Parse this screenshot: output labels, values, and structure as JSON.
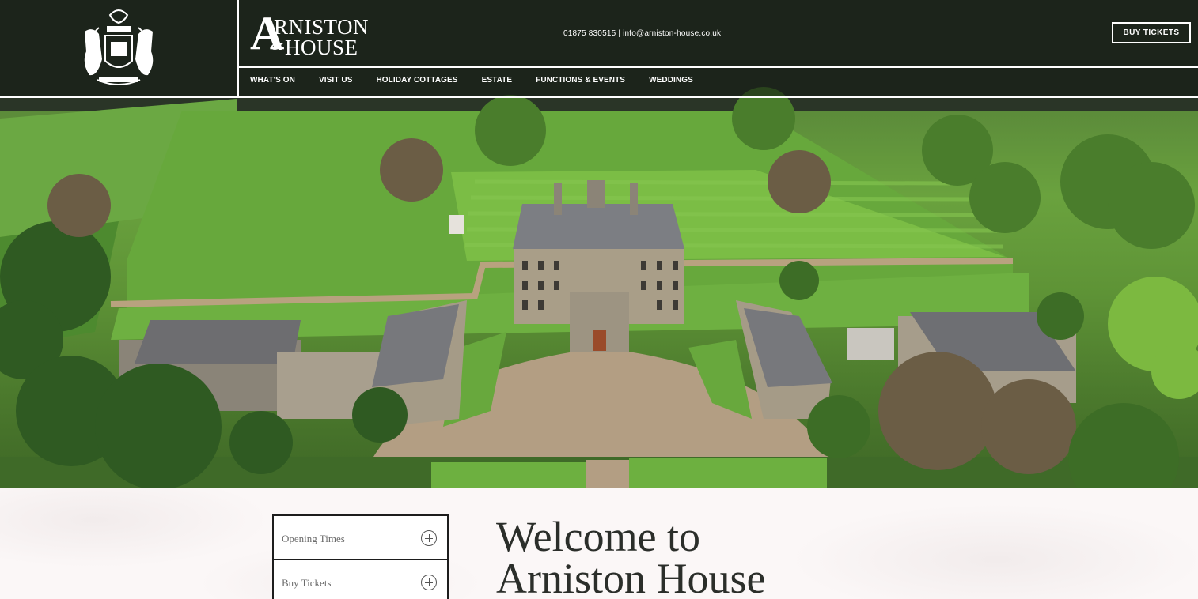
{
  "brand": {
    "logo_letter": "A",
    "logo_line1": "RNISTON",
    "logo_amp": "&",
    "logo_line2": "HOUSE",
    "crest_icon": "coat-of-arms-icon"
  },
  "header": {
    "contact": "01875 830515 | info@arniston-house.co.uk",
    "buy_tickets": "BUY TICKETS"
  },
  "nav": {
    "items": [
      {
        "label": "WHAT'S ON"
      },
      {
        "label": "VISIT US"
      },
      {
        "label": "HOLIDAY COTTAGES"
      },
      {
        "label": "ESTATE"
      },
      {
        "label": "FUNCTIONS & EVENTS"
      },
      {
        "label": "WEDDINGS"
      }
    ]
  },
  "hero": {
    "image": "aerial-view-of-arniston-house"
  },
  "sidebar": {
    "items": [
      {
        "label": "Opening Times",
        "icon": "plus-circle-icon"
      },
      {
        "label": "Buy Tickets",
        "icon": "plus-circle-icon"
      }
    ]
  },
  "main": {
    "heading_line1": "Welcome to",
    "heading_line2": "Arniston House"
  },
  "colors": {
    "header_overlay": "#101612",
    "accent_text": "#2b2e2a",
    "border": "#1d1d1d"
  }
}
